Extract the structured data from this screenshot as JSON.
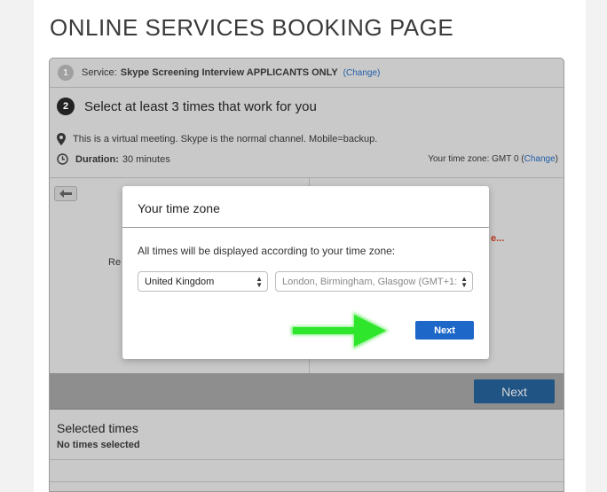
{
  "page": {
    "title": "ONLINE SERVICES BOOKING PAGE"
  },
  "steps": {
    "step1": {
      "number": "1",
      "prefix": "Service:",
      "service_name": "Skype Screening Interview APPLICANTS ONLY",
      "change_label": "(Change)"
    },
    "step2": {
      "number": "2",
      "label": "Select at least 3 times that work for you"
    }
  },
  "meeting": {
    "location_text": "This is a virtual meeting. Skype is the normal channel. Mobile=backup.",
    "duration_label": "Duration:",
    "duration_value": "30 minutes",
    "timezone_text": "Your time zone: GMT 0 (",
    "timezone_change": "Change",
    "timezone_close": ")"
  },
  "calendar": {
    "partial_left": "Re",
    "partial_right": "e..."
  },
  "footer": {
    "next_label": "Next"
  },
  "selected": {
    "title": "Selected times",
    "empty_text": "No times selected"
  },
  "modal": {
    "title": "Your time zone",
    "description": "All times will be displayed according to your time zone:",
    "country_value": "United Kingdom",
    "city_value": "London, Birmingham, Glasgow (GMT+1:",
    "next_label": "Next"
  },
  "colors": {
    "accent_blue": "#1d67c8",
    "dark_blue": "#1f5485",
    "arrow_green": "#2ee62b",
    "overlay_gray": "#c9c9c9"
  },
  "icons": [
    "map-pin-icon",
    "clock-icon",
    "back-arrow-icon",
    "green-arrow-icon"
  ]
}
